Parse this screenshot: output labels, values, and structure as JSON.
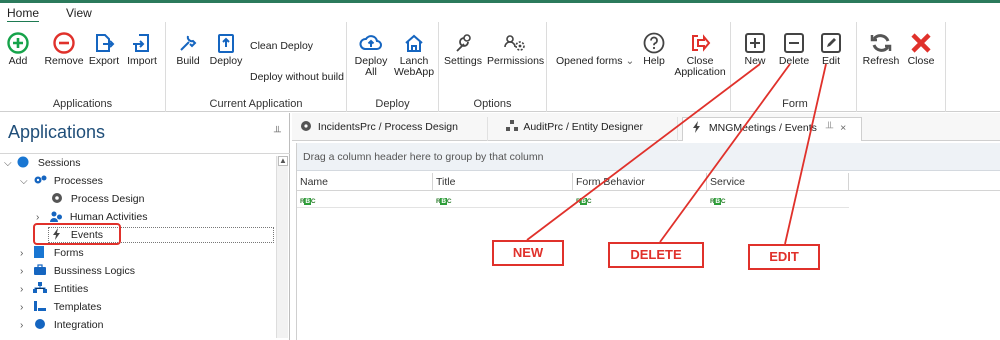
{
  "ribbon": {
    "tabs": [
      "Home",
      "View"
    ],
    "groups": {
      "applications": {
        "label": "Applications",
        "buttons": [
          "Add",
          "Remove",
          "Export",
          "Import"
        ]
      },
      "current_application": {
        "label": "Current Application",
        "buttons": [
          "Build",
          "Deploy"
        ],
        "small_buttons": [
          "Clean Deploy",
          "Deploy without build"
        ]
      },
      "deploy": {
        "label": "Deploy",
        "buttons": [
          [
            "Deploy",
            "All"
          ],
          [
            "Lanch",
            "WebApp"
          ]
        ]
      },
      "options": {
        "label": "Options",
        "buttons": [
          "Settings",
          "Permissions"
        ]
      },
      "misc": {
        "opened_forms": "Opened forms",
        "help": "Help",
        "close_application": [
          "Close",
          "Application"
        ]
      },
      "form": {
        "label": "Form",
        "buttons": [
          "New",
          "Delete",
          "Edit"
        ]
      },
      "right": {
        "buttons": [
          "Refresh",
          "Close"
        ]
      }
    }
  },
  "applications_panel": {
    "title": "Applications",
    "tree": [
      {
        "label": "Sessions",
        "arrow": "v"
      },
      {
        "label": "Processes",
        "arrow": "v"
      },
      {
        "label": "Process Design",
        "arrow": ""
      },
      {
        "label": "Human Activities",
        "arrow": ">"
      },
      {
        "label": "Events",
        "arrow": ""
      },
      {
        "label": "Forms",
        "arrow": ">"
      },
      {
        "label": "Bussiness Logics",
        "arrow": ">"
      },
      {
        "label": "Entities",
        "arrow": ">"
      },
      {
        "label": "Templates",
        "arrow": ">"
      },
      {
        "label": "Integration",
        "arrow": ">"
      }
    ]
  },
  "doc_tabs": [
    {
      "label": "IncidentsPrc / Process Design"
    },
    {
      "label": "AuditPrc / Entity Designer"
    },
    {
      "label": "MNGMeetings / Events"
    }
  ],
  "grid": {
    "group_hint": "Drag a column header here to group by that column",
    "columns": [
      "Name",
      "Title",
      "Form Behavior",
      "Service"
    ],
    "filter_glyph": "RBC"
  },
  "annotations": {
    "new": "NEW",
    "delete": "DELETE",
    "edit": "EDIT",
    "color": "#e0312b"
  },
  "colors": {
    "accent_green": "#1e7a52",
    "icon_red": "#e0312b",
    "icon_blue": "#1565c0",
    "title_blue": "#1f4e79"
  }
}
